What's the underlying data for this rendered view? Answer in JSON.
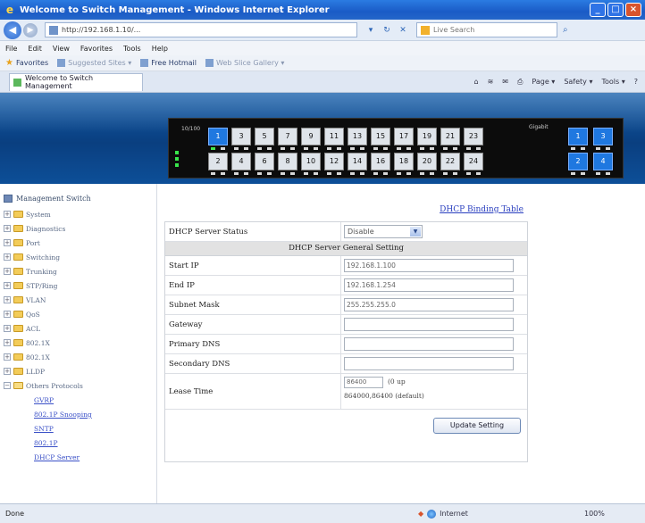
{
  "window": {
    "title": "Welcome to Switch Management - Windows Internet Explorer",
    "controls": [
      "_",
      "□",
      "×"
    ]
  },
  "address": {
    "url": "http://192.168.1.10/...",
    "search_placeholder": "Live Search"
  },
  "menu": [
    "File",
    "Edit",
    "View",
    "Favorites",
    "Tools",
    "Help"
  ],
  "favorites": {
    "label": "Favorites",
    "items": [
      "Suggested Sites ▾",
      "Free Hotmail",
      "Web Slice Gallery ▾"
    ]
  },
  "tab": {
    "label": "Welcome to Switch Management"
  },
  "commandbar": [
    "Page ▾",
    "Safety ▾",
    "Tools ▾"
  ],
  "switch_panel": {
    "left_label": "10/100",
    "right_label": "Gigabit",
    "top_ports": [
      "1",
      "3",
      "5",
      "7",
      "9",
      "11",
      "13",
      "15",
      "17",
      "19",
      "21",
      "23"
    ],
    "bottom_ports": [
      "2",
      "4",
      "6",
      "8",
      "10",
      "12",
      "14",
      "16",
      "18",
      "20",
      "22",
      "24"
    ],
    "gig_top": [
      "1",
      "3"
    ],
    "gig_bottom": [
      "2",
      "4"
    ],
    "active_ports": [
      "1",
      "2",
      "3",
      "4"
    ]
  },
  "sidebar": {
    "root": "Management Switch",
    "items": [
      {
        "label": "System",
        "expanded": false
      },
      {
        "label": "Diagnostics",
        "expanded": false
      },
      {
        "label": "Port",
        "expanded": false
      },
      {
        "label": "Switching",
        "expanded": false
      },
      {
        "label": "Trunking",
        "expanded": false
      },
      {
        "label": "STP/Ring",
        "expanded": false
      },
      {
        "label": "VLAN",
        "expanded": false
      },
      {
        "label": "QoS",
        "expanded": false
      },
      {
        "label": "ACL",
        "expanded": false
      },
      {
        "label": "802.1X",
        "expanded": false
      },
      {
        "label": "802.1X",
        "expanded": false
      },
      {
        "label": "LLDP",
        "expanded": false
      },
      {
        "label": "Others Protocols",
        "expanded": true
      }
    ],
    "subitems": [
      "GVRP",
      "802.1P Snooping",
      "SNTP",
      "802.1P",
      "DHCP Server"
    ]
  },
  "main": {
    "binding_link": "DHCP Binding Table",
    "server_status_label": "DHCP Server Status",
    "server_status_value": "Disable",
    "section_title": "DHCP Server General Setting",
    "fields": [
      {
        "label": "Start IP",
        "value": "192.168.1.100"
      },
      {
        "label": "End IP",
        "value": "192.168.1.254"
      },
      {
        "label": "Subnet Mask",
        "value": "255.255.255.0"
      },
      {
        "label": "Gateway",
        "value": ""
      },
      {
        "label": "Primary DNS",
        "value": ""
      },
      {
        "label": "Secondary DNS",
        "value": ""
      }
    ],
    "lease": {
      "label": "Lease Time",
      "value": "86400",
      "unit": "(0 up",
      "range": "864000,86400 (default)"
    },
    "update_button": "Update Setting"
  },
  "status": {
    "left": "Done",
    "zone": "Internet",
    "zoom": "100%"
  }
}
